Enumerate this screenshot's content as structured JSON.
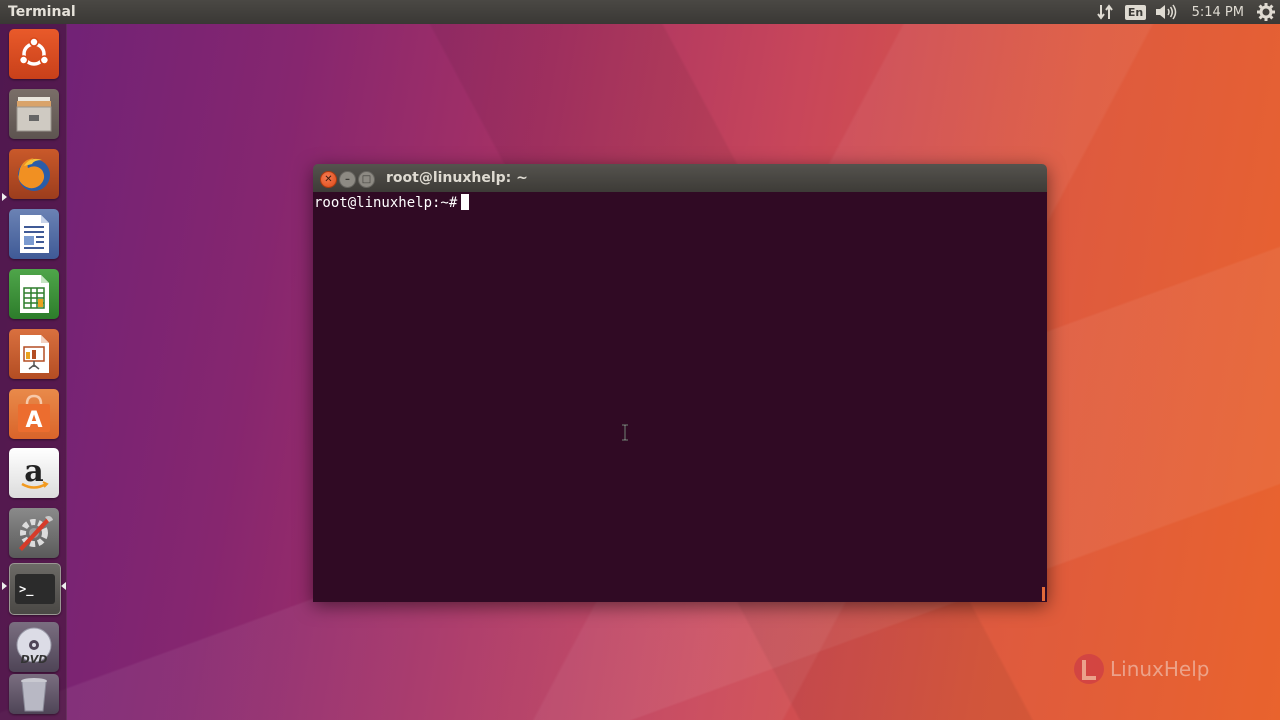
{
  "top_panel": {
    "app_title": "Terminal",
    "language": "En",
    "clock": "5:14 PM",
    "icons": [
      "network-transfer-icon",
      "keyboard-language-icon",
      "volume-icon",
      "system-gear-icon"
    ]
  },
  "launcher": {
    "items": [
      {
        "name": "ubuntu-dash",
        "icon": "ubuntu-logo-icon"
      },
      {
        "name": "files",
        "icon": "file-cabinet-icon"
      },
      {
        "name": "firefox",
        "icon": "firefox-icon"
      },
      {
        "name": "libreoffice-writer",
        "icon": "writer-document-icon"
      },
      {
        "name": "libreoffice-calc",
        "icon": "calc-spreadsheet-icon"
      },
      {
        "name": "libreoffice-impress",
        "icon": "impress-presentation-icon"
      },
      {
        "name": "software-center",
        "icon": "shopping-bag-icon",
        "label": "A"
      },
      {
        "name": "amazon",
        "icon": "amazon-icon",
        "label": "a"
      },
      {
        "name": "system-settings",
        "icon": "settings-tools-icon"
      },
      {
        "name": "terminal",
        "icon": "terminal-icon",
        "label": ">_"
      },
      {
        "name": "dvd",
        "icon": "dvd-disc-icon",
        "label": "DVD"
      },
      {
        "name": "trash",
        "icon": "trash-icon"
      }
    ]
  },
  "terminal_window": {
    "title": "root@linuxhelp: ~",
    "prompt": "root@linuxhelp:~#",
    "colors": {
      "background": "#300a24",
      "text": "#ffffff",
      "close": "#df4a16"
    }
  },
  "watermark": {
    "text": "LinuxHelp"
  }
}
